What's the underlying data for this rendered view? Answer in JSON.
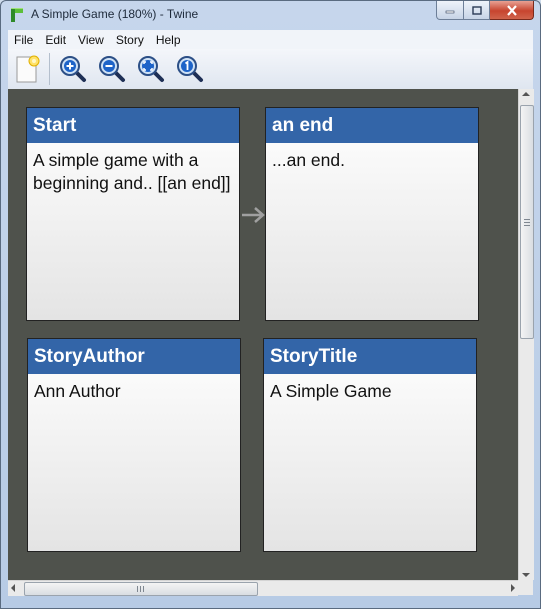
{
  "window": {
    "title": "A Simple Game (180%) - Twine"
  },
  "menu": [
    {
      "id": "file",
      "label": "File"
    },
    {
      "id": "edit",
      "label": "Edit"
    },
    {
      "id": "view",
      "label": "View"
    },
    {
      "id": "story",
      "label": "Story"
    },
    {
      "id": "help",
      "label": "Help"
    }
  ],
  "toolbar": {
    "buttons": [
      "new-passage-icon",
      "zoom-in-icon",
      "zoom-out-icon",
      "zoom-fit-icon",
      "zoom-actual-icon"
    ]
  },
  "passages": [
    {
      "id": "start",
      "title": "Start",
      "text": "A simple game with a beginning and.. [[an end]]"
    },
    {
      "id": "an-end",
      "title": "an end",
      "text": "...an end."
    },
    {
      "id": "storyauthor",
      "title": "StoryAuthor",
      "text": "Ann Author"
    },
    {
      "id": "storytitle",
      "title": "StoryTitle",
      "text": "A Simple Game"
    }
  ],
  "colors": {
    "passage_header": "#3365a8",
    "canvas_background": "#4f524c",
    "link_arrow": "#a0a0a0"
  }
}
